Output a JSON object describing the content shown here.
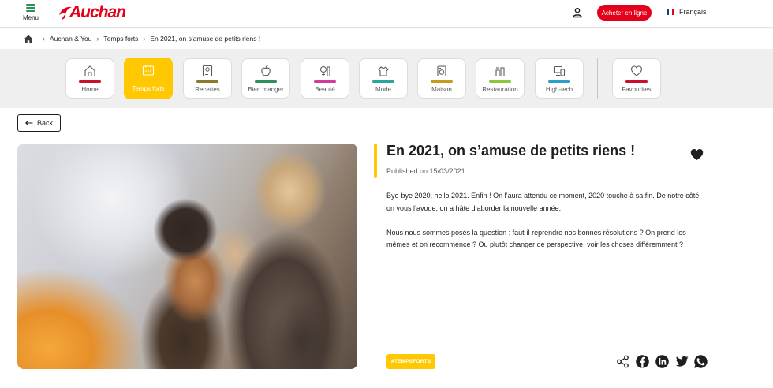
{
  "header": {
    "menu_label": "Menu",
    "logo_text": "Auchan",
    "buy_button": "Acheter en ligne",
    "language": "Français",
    "brand_color": "#e2001a"
  },
  "breadcrumb": {
    "items": [
      "Auchan & You",
      "Temps forts",
      "En 2021, on s’amuse de petits riens !"
    ]
  },
  "categories": [
    {
      "label": "Home",
      "icon": "house-icon",
      "color": "#c8102e",
      "active": false
    },
    {
      "label": "Temps forts",
      "icon": "calendar-icon",
      "color": "#ffffff",
      "active": true
    },
    {
      "label": "Recettes",
      "icon": "recipe-icon",
      "color": "#8a7a2a",
      "active": false
    },
    {
      "label": "Bien manger",
      "icon": "apple-icon",
      "color": "#2f8f5b",
      "active": false
    },
    {
      "label": "Beauté",
      "icon": "beauty-icon",
      "color": "#d43a9b",
      "active": false
    },
    {
      "label": "Mode",
      "icon": "mode-icon",
      "color": "#2aa79b",
      "active": false
    },
    {
      "label": "Maison",
      "icon": "home-appliance-icon",
      "color": "#c79a1e",
      "active": false
    },
    {
      "label": "Restauration",
      "icon": "restaurant-icon",
      "color": "#8cc63f",
      "active": false
    },
    {
      "label": "High-tech",
      "icon": "tech-icon",
      "color": "#2aa0c9",
      "active": false
    },
    {
      "label": "Favourites",
      "icon": "heart-outline-icon",
      "color": "#c8102e",
      "active": false
    }
  ],
  "back_label": "Back",
  "article": {
    "title": "En 2021, on s’amuse de petits riens !",
    "date": "Published on 15/03/2021",
    "paragraphs": [
      "Bye-bye 2020, hello 2021. Enfin ! On l’aura attendu ce moment, 2020 touche à sa fin. De notre côté, on vous l’avoue, on a hâte d’aborder la nouvelle année.",
      "Nous nous sommes posés la question : faut-il reprendre nos bonnes résolutions ? On prend les mêmes et on recommence ? Ou plutôt changer de perspective, voir les choses différemment ?"
    ],
    "tag": "#TEMPSFORTS",
    "accent_color": "#ffc800"
  },
  "share_icons": [
    "share-icon",
    "facebook-icon",
    "linkedin-icon",
    "twitter-icon",
    "whatsapp-icon"
  ]
}
